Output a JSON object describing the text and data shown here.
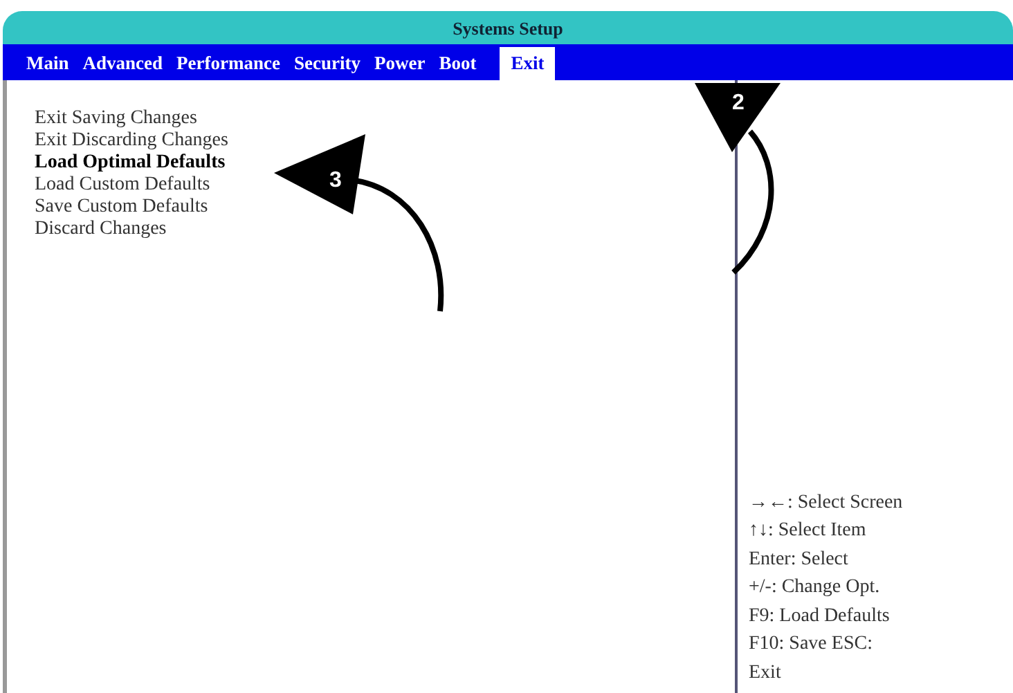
{
  "window": {
    "title": "Systems Setup"
  },
  "tabs": [
    {
      "label": "Main",
      "selected": false
    },
    {
      "label": "Advanced",
      "selected": false
    },
    {
      "label": "Performance",
      "selected": false
    },
    {
      "label": "Security",
      "selected": false
    },
    {
      "label": "Power",
      "selected": false
    },
    {
      "label": "Boot",
      "selected": false
    },
    {
      "label": "Exit",
      "selected": true
    }
  ],
  "options": [
    {
      "label": "Exit Saving Changes",
      "selected": false
    },
    {
      "label": "Exit Discarding Changes",
      "selected": false
    },
    {
      "label": "Load Optimal Defaults",
      "selected": true
    },
    {
      "label": "Load Custom Defaults",
      "selected": false
    },
    {
      "label": "Save Custom Defaults",
      "selected": false
    },
    {
      "label": "Discard Changes",
      "selected": false
    }
  ],
  "help": [
    "→←: Select Screen",
    "↑↓: Select Item",
    "Enter: Select",
    "+/-: Change Opt.",
    "F9: Load Defaults",
    "F10: Save ESC:",
    "Exit"
  ],
  "callouts": [
    {
      "number": "2",
      "kind": "down"
    },
    {
      "number": "3",
      "kind": "left"
    }
  ]
}
